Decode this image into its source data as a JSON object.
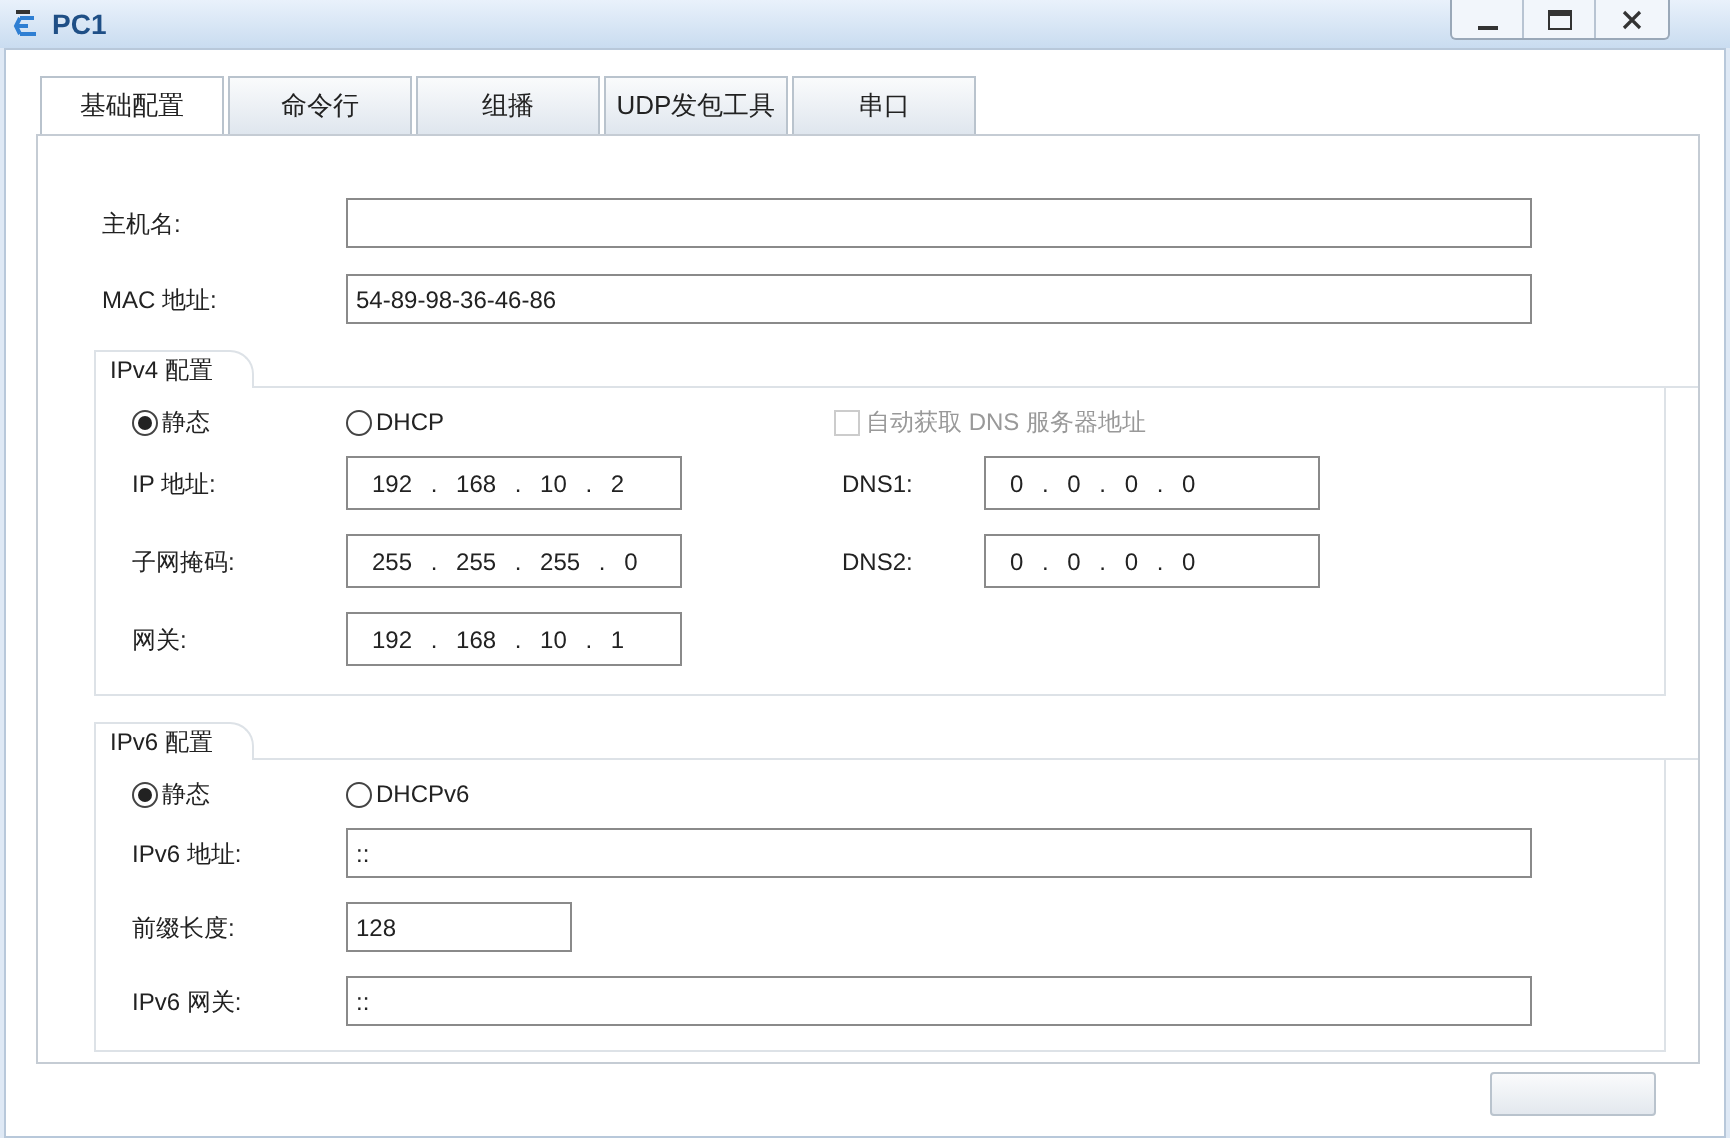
{
  "window": {
    "title": "PC1"
  },
  "tabs": [
    {
      "label": "基础配置",
      "selected": true
    },
    {
      "label": "命令行",
      "selected": false
    },
    {
      "label": "组播",
      "selected": false
    },
    {
      "label": "UDP发包工具",
      "selected": false
    },
    {
      "label": "串口",
      "selected": false
    }
  ],
  "host_fields": [
    {
      "label": "主机名:"
    },
    {
      "label": "MAC 地址:",
      "value": "54-89-98-36-46-86"
    }
  ],
  "ipv4": {
    "title": "IPv4 配置",
    "modes": [
      {
        "label": "静态",
        "selected": true
      },
      {
        "label": "DHCP",
        "selected": false
      }
    ],
    "auto_dns": {
      "label": "自动获取 DNS 服务器地址",
      "checked": false,
      "disabled": true
    },
    "rows": [
      {
        "label": "IP 地址:",
        "value": "192 . 168 . 10 . 2",
        "dns_label": "DNS1:",
        "dns_value": "0 . 0 . 0 . 0"
      },
      {
        "label": "子网掩码:",
        "value": "255 . 255 . 255 . 0",
        "dns_label": "DNS2:",
        "dns_value": "0 . 0 . 0 . 0"
      },
      {
        "label": "网关:",
        "value": "192 . 168 . 10 . 1"
      }
    ]
  },
  "ipv6": {
    "title": "IPv6 配置",
    "modes": [
      {
        "label": "静态",
        "selected": true
      },
      {
        "label": "DHCPv6",
        "selected": false
      }
    ],
    "fields": [
      {
        "label": "IPv6 地址:",
        "value": "::",
        "wide": true
      },
      {
        "label": "前缀长度:",
        "value": "128",
        "wide": false
      },
      {
        "label": "IPv6 网关:",
        "value": "::",
        "wide": true
      }
    ]
  }
}
